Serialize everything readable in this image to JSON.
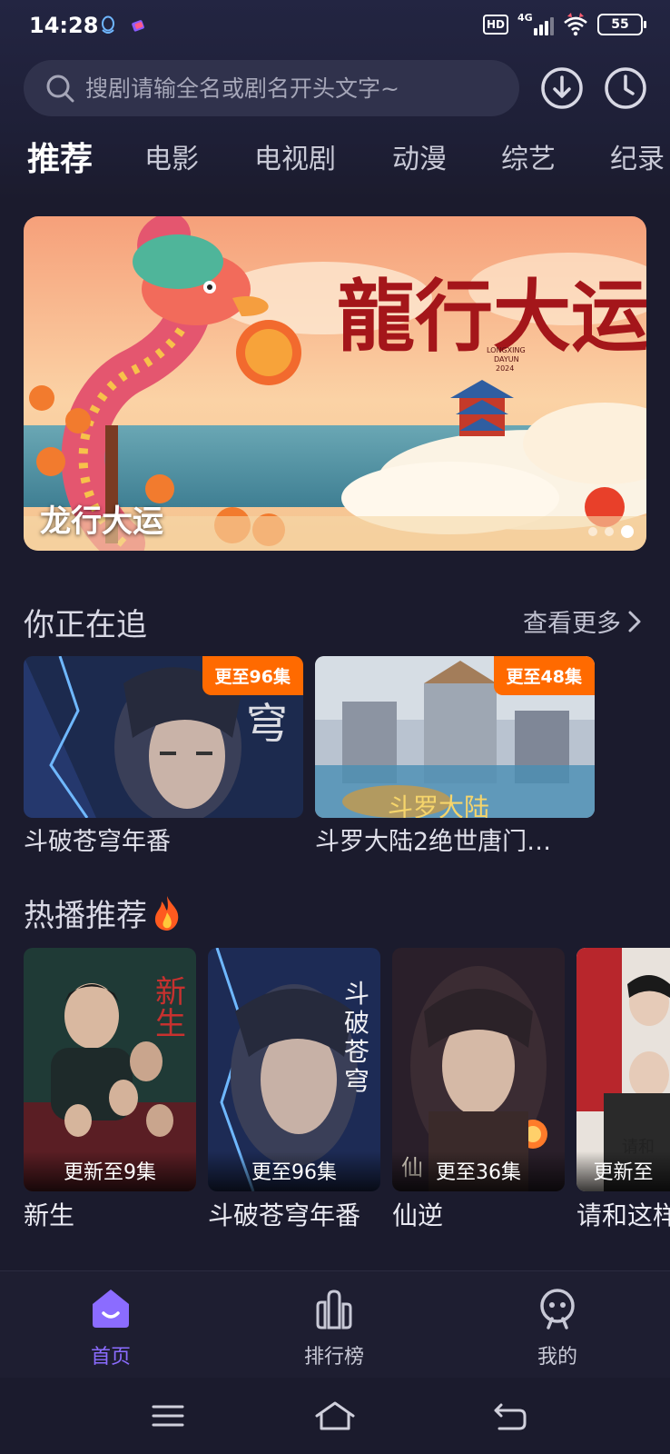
{
  "status": {
    "time": "14:28",
    "hd": "HD",
    "network": "4G",
    "battery": "55"
  },
  "search": {
    "placeholder": "搜剧请输全名或剧名开头文字~"
  },
  "tabs": [
    "推荐",
    "电影",
    "电视剧",
    "动漫",
    "综艺",
    "纪录"
  ],
  "banner": {
    "title": "龙行大运",
    "art_text": "龍行大运",
    "art_sub1": "LONGXING",
    "art_sub2": "DAYUN",
    "art_year": "2024",
    "page_count": 3,
    "active_page": 3
  },
  "watching": {
    "title": "你正在追",
    "more": "查看更多",
    "items": [
      {
        "title": "斗破苍穹年番",
        "badge": "更至96集"
      },
      {
        "title": "斗罗大陆2绝世唐门…",
        "badge": "更至48集"
      }
    ]
  },
  "hot": {
    "title": "热播推荐",
    "items": [
      {
        "title": "新生",
        "episode": "更新至9集"
      },
      {
        "title": "斗破苍穹年番",
        "episode": "更至96集"
      },
      {
        "title": "仙逆",
        "episode": "更至36集"
      },
      {
        "title": "请和这样",
        "episode": "更新至"
      }
    ]
  },
  "nav": {
    "home": "首页",
    "ranking": "排行榜",
    "mine": "我的"
  },
  "colors": {
    "accent": "#8b6cff",
    "badge": "#ff6a00",
    "background": "#1b1b2d"
  }
}
